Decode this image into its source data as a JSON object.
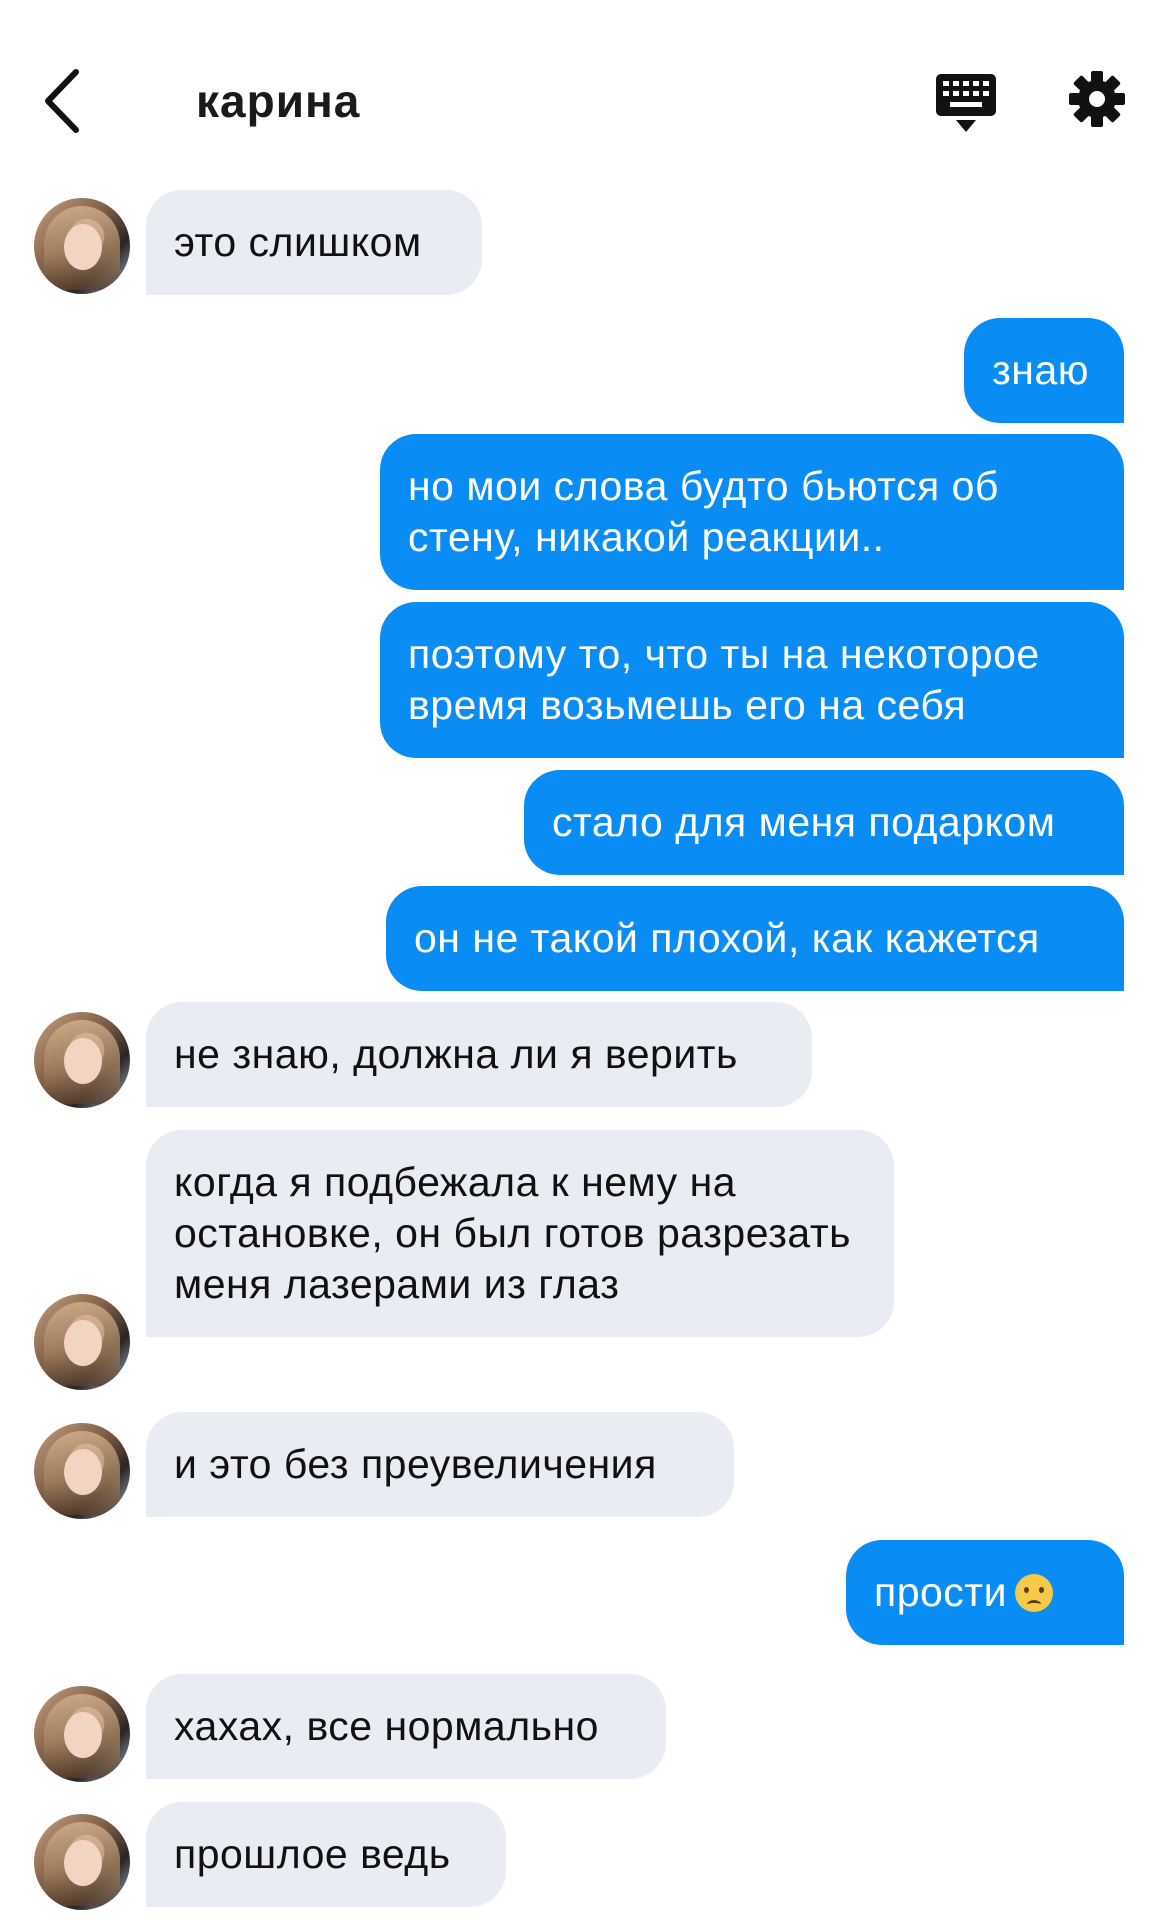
{
  "header": {
    "title": "карина",
    "back_icon": "chevron-left-icon",
    "keyboard_icon": "keyboard-icon",
    "settings_icon": "gear-icon"
  },
  "colors": {
    "outgoing": "#0a8cf5",
    "incoming": "#e9ecf3"
  },
  "messages": [
    {
      "dir": "in",
      "text": "это слишком"
    },
    {
      "dir": "out",
      "text": "знаю"
    },
    {
      "dir": "out",
      "text": "но мои слова будто бьются об стену, никакой реакции.."
    },
    {
      "dir": "out",
      "text": "поэтому то, что ты на некоторое время возьмешь его на себя"
    },
    {
      "dir": "out",
      "text": "стало для меня подарком"
    },
    {
      "dir": "out",
      "text": "он не такой плохой, как кажется"
    },
    {
      "dir": "in",
      "text": "не знаю, должна ли я верить"
    },
    {
      "dir": "in",
      "text": "когда я подбежала к нему на остановке, он был готов разрезать меня лазерами из глаз"
    },
    {
      "dir": "in",
      "text": "и это без преувеличения"
    },
    {
      "dir": "out",
      "text": "прости",
      "emoji": "sad-face-emoji"
    },
    {
      "dir": "in",
      "text": "хахах, все нормально"
    },
    {
      "dir": "in",
      "text": "прошлое ведь"
    }
  ]
}
